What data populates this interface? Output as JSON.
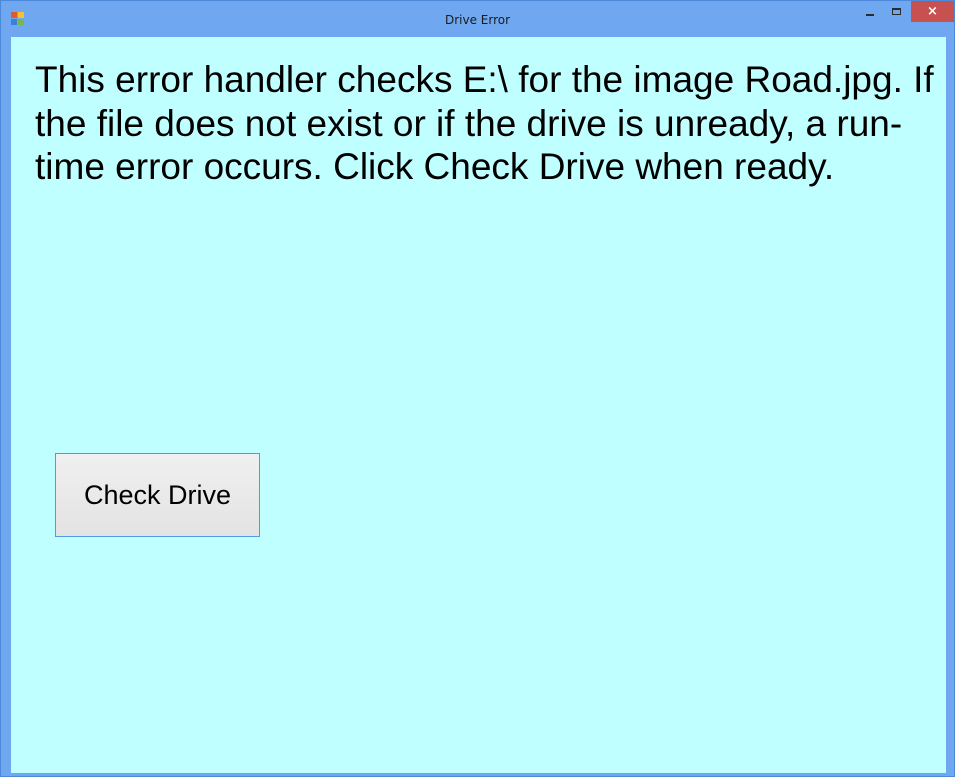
{
  "window": {
    "title": "Drive Error",
    "controls": {
      "minimize_icon": "minimize-icon",
      "maximize_icon": "maximize-icon",
      "close_icon": "close-icon",
      "close_glyph": "×"
    }
  },
  "main": {
    "message": "This error handler checks E:\\ for the image Road.jpg. If the file does not exist or if the drive is unready, a run-time error occurs. Click Check Drive when ready.",
    "check_button_label": "Check Drive"
  },
  "colors": {
    "titlebar": "#6fa8f0",
    "client_background": "#c0ffff",
    "close_button": "#c75050",
    "button_border": "#4f9bea"
  }
}
